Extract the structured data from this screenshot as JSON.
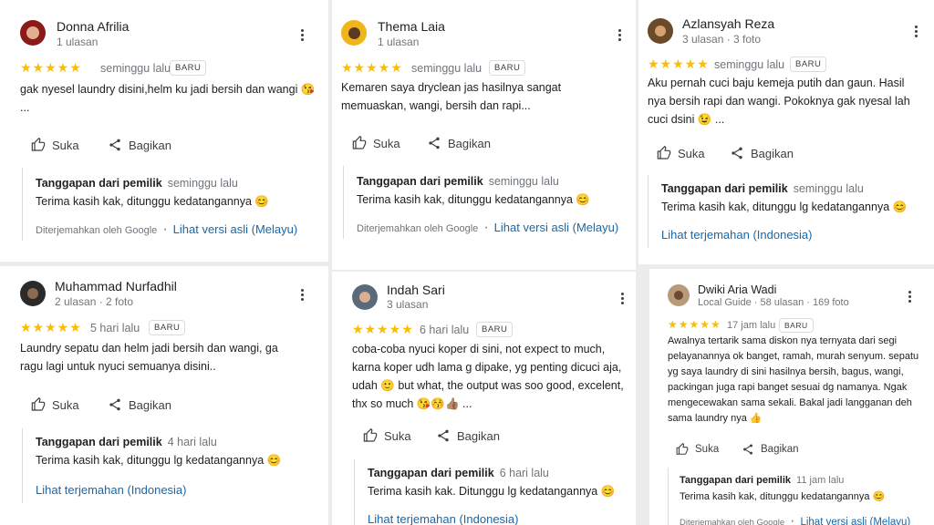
{
  "labels": {
    "new_badge": "BARU",
    "like": "Suka",
    "share": "Bagikan",
    "owner_reply": "Tanggapan dari pemilik",
    "translated_by": "Diterjemahkan oleh Google",
    "see_original_malay": "Lihat versi asli (Melayu)",
    "see_translation_indonesia": "Lihat terjemahan (Indonesia)"
  },
  "reviews": [
    {
      "name": "Donna Afrilia",
      "meta": "1 ulasan",
      "rating": "★★★★★",
      "date": "seminggu lalu",
      "text": "gak nyesel laundry disini,helm ku jadi bersih dan wangi 😘 ...",
      "reply_date": "seminggu lalu",
      "reply_text": "Terima kasih kak, ditunggu kedatangannya 😊"
    },
    {
      "name": "Thema Laia",
      "meta": "1 ulasan",
      "rating": "★★★★★",
      "date": "seminggu lalu",
      "text": "Kemaren saya dryclean jas hasilnya sangat memuaskan, wangi, bersih dan rapi...",
      "reply_date": "seminggu lalu",
      "reply_text": "Terima kasih kak, ditunggu kedatangannya 😊"
    },
    {
      "name": "Azlansyah Reza",
      "meta": "3 ulasan · 3 foto",
      "rating": "★★★★★",
      "date": "seminggu lalu",
      "text": "Aku pernah cuci baju kemeja putih dan gaun. Hasil nya bersih rapi dan wangi. Pokoknya gak nyesal lah cuci dsini 😉 ...",
      "reply_date": "seminggu lalu",
      "reply_text": "Terima kasih kak, ditunggu lg kedatangannya 😊"
    },
    {
      "name": "Muhammad Nurfadhil",
      "meta": "2 ulasan · 2 foto",
      "rating": "★★★★★",
      "date": "5 hari lalu",
      "text": "Laundry sepatu dan helm jadi bersih dan wangi, ga ragu lagi untuk nyuci semuanya disini..",
      "reply_date": "4 hari lalu",
      "reply_text": "Terima kasih kak, ditunggu lg kedatangannya 😊"
    },
    {
      "name": "Indah Sari",
      "meta": "3 ulasan",
      "rating": "★★★★★",
      "date": "6 hari lalu",
      "text": "coba-coba nyuci koper di sini, not expect to much, karna koper udh lama g dipake, yg penting dicuci aja, udah 🙂 but what, the output was soo good, excelent, thx so much 😘😚👍🏽 ...",
      "reply_date": "6 hari lalu",
      "reply_text": "Terima kasih kak. Ditunggu lg kedatangannya 😊"
    },
    {
      "name": "Dwiki Aria Wadi",
      "meta": "Local Guide · 58 ulasan · 169 foto",
      "rating": "★★★★★",
      "date": "17 jam lalu",
      "text": "Awalnya tertarik sama diskon nya ternyata dari segi pelayanannya ok banget, ramah, murah senyum. sepatu yg saya laundry di sini hasilnya bersih, bagus, wangi, packingan juga rapi banget sesuai dg namanya. Ngak mengecewakan sama sekali. Bakal jadi langganan deh sama laundry nya 👍",
      "reply_date": "11 jam lalu",
      "reply_text": "Terima kasih kak, ditunggu kedatangannya 😊"
    }
  ],
  "colors": {
    "star": "#fbbc04",
    "link": "#1967a8",
    "background": "#ececec"
  }
}
